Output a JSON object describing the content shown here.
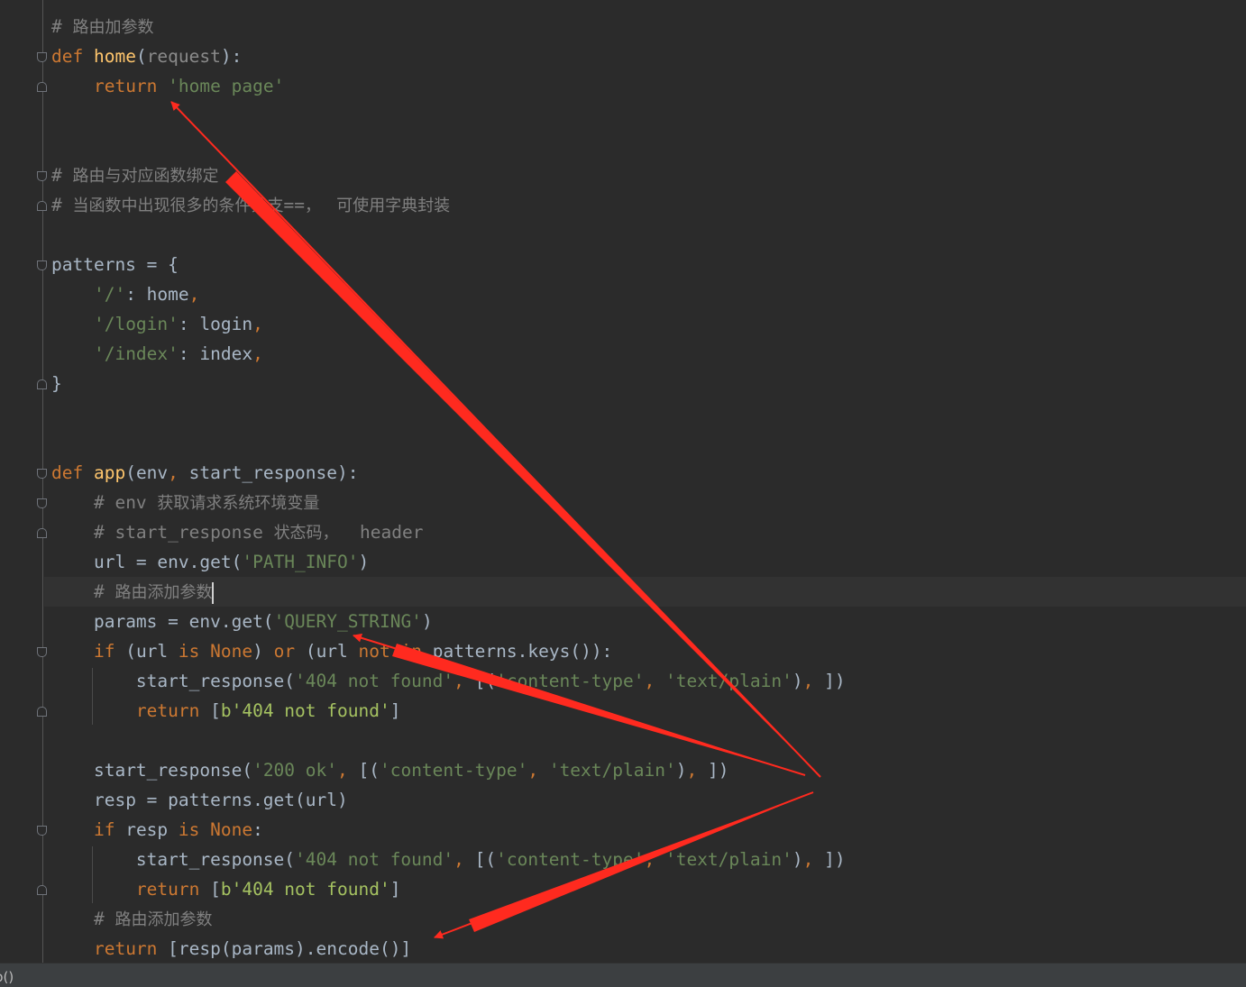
{
  "code": {
    "l1_cm": "# ",
    "l1_cn": "路由加参数",
    "l2_def": "def ",
    "l2_fn": "home",
    "l2_p1": "(",
    "l2_param": "request",
    "l2_p2": "):",
    "l3_kw": "return ",
    "l3_str": "'home page'",
    "l6_cm": "# ",
    "l6_cn": "路由与对应函数绑定",
    "l7_cm": "# ",
    "l7_cn1": "当函数中出现很多的条件分支",
    "l7_mid": "==",
    "l7_cn2": "，   可使用字典封装",
    "l9": "patterns = {",
    "l10_str": "'/'",
    "l10_rest": ": home",
    "l10_comma": ",",
    "l11_str": "'/login'",
    "l11_rest": ": login",
    "l11_comma": ",",
    "l12_str": "'/index'",
    "l12_rest": ": index",
    "l12_comma": ",",
    "l13": "}",
    "l16_def": "def ",
    "l16_fn": "app",
    "l16_p1": "(env",
    "l16_comma": ", ",
    "l16_p2": "start_response):",
    "l17_cm": "# env ",
    "l17_cn": "获取请求系统环境变量",
    "l18_cm": "# start_response ",
    "l18_cn": "状态码，",
    "l18_cm2": "  header",
    "l19_a": "url = env.get(",
    "l19_str": "'PATH_INFO'",
    "l19_b": ")",
    "l20_cm": "# ",
    "l20_cn": "路由添加参数",
    "l21_a": "params = env.get(",
    "l21_str": "'QUERY_STRING'",
    "l21_b": ")",
    "l22_if": "if ",
    "l22_a": "(url ",
    "l22_is": "is ",
    "l22_none": "None",
    "l22_b": ") ",
    "l22_or": "or ",
    "l22_c": "(url ",
    "l22_notin": "not in ",
    "l22_d": "patterns.keys()):",
    "l23_a": "start_response(",
    "l23_s1": "'404 not found'",
    "l23_c1": ", ",
    "l23_b": "[(",
    "l23_s2": "'content-type'",
    "l23_c2": ", ",
    "l23_s3": "'text/plain'",
    "l23_c": ")",
    "l23_c3": ", ",
    "l23_d": "])",
    "l24_ret": "return ",
    "l24_a": "[",
    "l24_b": "b'404 not found'",
    "l24_c": "]",
    "l26_a": "start_response(",
    "l26_s1": "'200 ok'",
    "l26_c1": ", ",
    "l26_b": "[(",
    "l26_s2": "'content-type'",
    "l26_c2": ", ",
    "l26_s3": "'text/plain'",
    "l26_c": ")",
    "l26_c3": ", ",
    "l26_d": "])",
    "l27": "resp = patterns.get(url)",
    "l28_if": "if ",
    "l28_a": "resp ",
    "l28_is": "is ",
    "l28_none": "None",
    "l28_b": ":",
    "l29_a": "start_response(",
    "l29_s1": "'404 not found'",
    "l29_c1": ", ",
    "l29_b": "[(",
    "l29_s2": "'content-type'",
    "l29_c2": ", ",
    "l29_s3": "'text/plain'",
    "l29_c": ")",
    "l29_c3": ", ",
    "l29_d": "])",
    "l30_ret": "return ",
    "l30_a": "[",
    "l30_b": "b'404 not found'",
    "l30_c": "]",
    "l31_cm": "# ",
    "l31_cn": "路由添加参数",
    "l32_ret": "return ",
    "l32_a": "[resp(params).encode()]"
  },
  "statusbar": {
    "breadcrumb": "p()"
  },
  "colors": {
    "background": "#2b2b2b",
    "keyword": "#cc7832",
    "function": "#ffc66d",
    "string": "#6a8759",
    "comment": "#808080",
    "annotation_arrow": "#ff2a1f"
  }
}
